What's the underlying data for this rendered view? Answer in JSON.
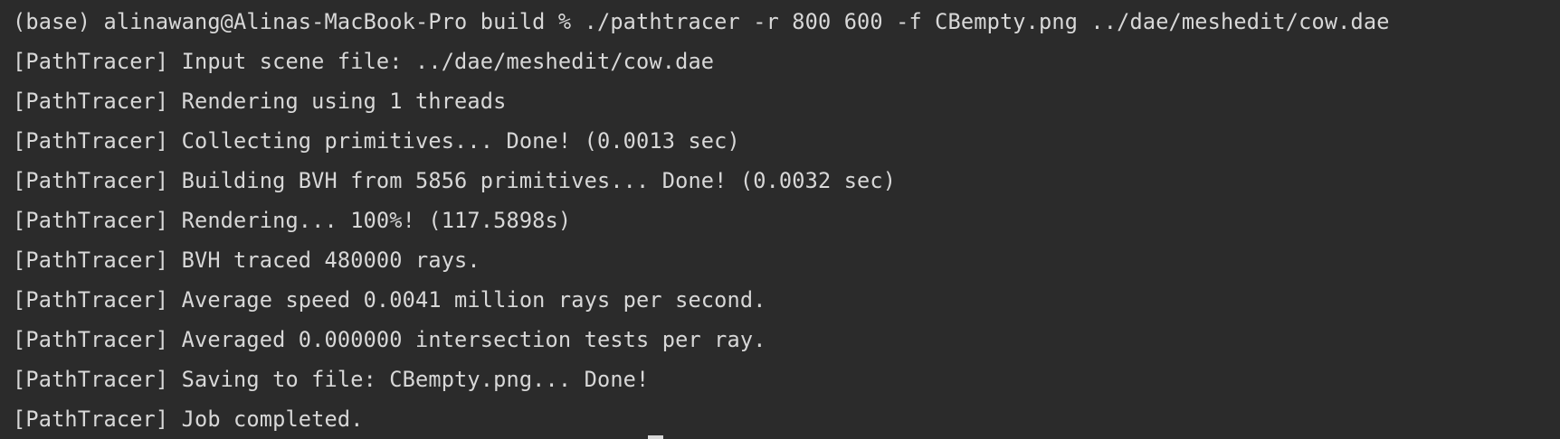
{
  "terminal": {
    "lines": [
      "(base) alinawang@Alinas-MacBook-Pro build % ./pathtracer -r 800 600 -f CBempty.png ../dae/meshedit/cow.dae",
      "[PathTracer] Input scene file: ../dae/meshedit/cow.dae",
      "[PathTracer] Rendering using 1 threads",
      "[PathTracer] Collecting primitives... Done! (0.0013 sec)",
      "[PathTracer] Building BVH from 5856 primitives... Done! (0.0032 sec)",
      "[PathTracer] Rendering... 100%! (117.5898s)",
      "[PathTracer] BVH traced 480000 rays.",
      "[PathTracer] Average speed 0.0041 million rays per second.",
      "[PathTracer] Averaged 0.000000 intersection tests per ray.",
      "[PathTracer] Saving to file: CBempty.png... Done!",
      "[PathTracer] Job completed."
    ]
  },
  "colors": {
    "background": "#2b2b2b",
    "text": "#d8d8d8"
  }
}
